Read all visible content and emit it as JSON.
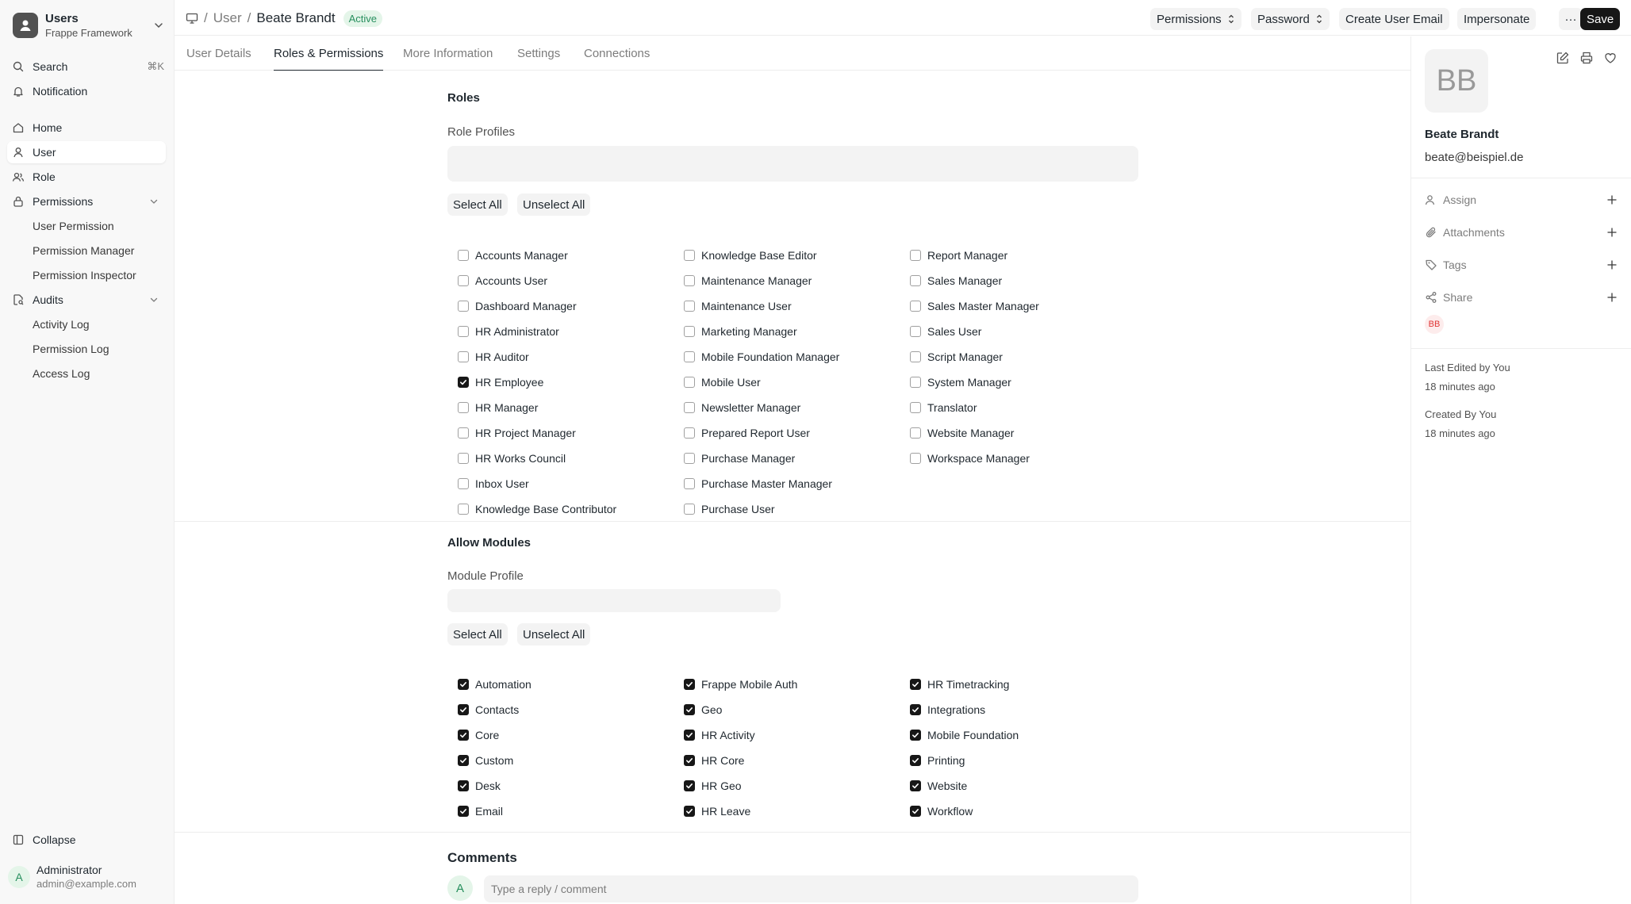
{
  "sidebar": {
    "app_title": "Users",
    "app_subtitle": "Frappe Framework",
    "search": "Search",
    "search_kbd": "⌘K",
    "notification": "Notification",
    "home": "Home",
    "user": "User",
    "role": "Role",
    "permissions": "Permissions",
    "permissions_items": [
      "User Permission",
      "Permission Manager",
      "Permission Inspector"
    ],
    "audits": "Audits",
    "audits_items": [
      "Activity Log",
      "Permission Log",
      "Access Log"
    ],
    "collapse": "Collapse",
    "footer_avatar": "A",
    "footer_name": "Administrator",
    "footer_email": "admin@example.com"
  },
  "header": {
    "crumb_user": "User",
    "crumb_name": "Beate Brandt",
    "status": "Active",
    "permissions_btn": "Permissions",
    "password_btn": "Password",
    "create_email_btn": "Create User Email",
    "impersonate_btn": "Impersonate",
    "more_btn": "···",
    "save_btn": "Save"
  },
  "tabs": [
    "User Details",
    "Roles & Permissions",
    "More Information",
    "Settings",
    "Connections"
  ],
  "roles": {
    "title": "Roles",
    "profile_label": "Role Profiles",
    "select_all": "Select All",
    "unselect_all": "Unselect All",
    "columns": [
      [
        {
          "label": "Accounts Manager",
          "checked": false
        },
        {
          "label": "Accounts User",
          "checked": false
        },
        {
          "label": "Dashboard Manager",
          "checked": false
        },
        {
          "label": "HR Administrator",
          "checked": false
        },
        {
          "label": "HR Auditor",
          "checked": false
        },
        {
          "label": "HR Employee",
          "checked": true
        },
        {
          "label": "HR Manager",
          "checked": false
        },
        {
          "label": "HR Project Manager",
          "checked": false
        },
        {
          "label": "HR Works Council",
          "checked": false
        },
        {
          "label": "Inbox User",
          "checked": false
        },
        {
          "label": "Knowledge Base Contributor",
          "checked": false
        }
      ],
      [
        {
          "label": "Knowledge Base Editor",
          "checked": false
        },
        {
          "label": "Maintenance Manager",
          "checked": false
        },
        {
          "label": "Maintenance User",
          "checked": false
        },
        {
          "label": "Marketing Manager",
          "checked": false
        },
        {
          "label": "Mobile Foundation Manager",
          "checked": false
        },
        {
          "label": "Mobile User",
          "checked": false
        },
        {
          "label": "Newsletter Manager",
          "checked": false
        },
        {
          "label": "Prepared Report User",
          "checked": false
        },
        {
          "label": "Purchase Manager",
          "checked": false
        },
        {
          "label": "Purchase Master Manager",
          "checked": false
        },
        {
          "label": "Purchase User",
          "checked": false
        }
      ],
      [
        {
          "label": "Report Manager",
          "checked": false
        },
        {
          "label": "Sales Manager",
          "checked": false
        },
        {
          "label": "Sales Master Manager",
          "checked": false
        },
        {
          "label": "Sales User",
          "checked": false
        },
        {
          "label": "Script Manager",
          "checked": false
        },
        {
          "label": "System Manager",
          "checked": false
        },
        {
          "label": "Translator",
          "checked": false
        },
        {
          "label": "Website Manager",
          "checked": false
        },
        {
          "label": "Workspace Manager",
          "checked": false
        }
      ]
    ]
  },
  "modules": {
    "title": "Allow Modules",
    "profile_label": "Module Profile",
    "select_all": "Select All",
    "unselect_all": "Unselect All",
    "columns": [
      [
        {
          "label": "Automation",
          "checked": true
        },
        {
          "label": "Contacts",
          "checked": true
        },
        {
          "label": "Core",
          "checked": true
        },
        {
          "label": "Custom",
          "checked": true
        },
        {
          "label": "Desk",
          "checked": true
        },
        {
          "label": "Email",
          "checked": true
        }
      ],
      [
        {
          "label": "Frappe Mobile Auth",
          "checked": true
        },
        {
          "label": "Geo",
          "checked": true
        },
        {
          "label": "HR Activity",
          "checked": true
        },
        {
          "label": "HR Core",
          "checked": true
        },
        {
          "label": "HR Geo",
          "checked": true
        },
        {
          "label": "HR Leave",
          "checked": true
        }
      ],
      [
        {
          "label": "HR Timetracking",
          "checked": true
        },
        {
          "label": "Integrations",
          "checked": true
        },
        {
          "label": "Mobile Foundation",
          "checked": true
        },
        {
          "label": "Printing",
          "checked": true
        },
        {
          "label": "Website",
          "checked": true
        },
        {
          "label": "Workflow",
          "checked": true
        }
      ]
    ]
  },
  "comments": {
    "title": "Comments",
    "avatar": "A",
    "placeholder": "Type a reply / comment"
  },
  "right_panel": {
    "avatar_initials": "BB",
    "name": "Beate Brandt",
    "email": "beate@beispiel.de",
    "assign": "Assign",
    "attachments": "Attachments",
    "tags": "Tags",
    "share": "Share",
    "shared_avatar": "BB",
    "last_edited": "Last Edited by You",
    "last_edited_time": "18 minutes ago",
    "created": "Created By You",
    "created_time": "18 minutes ago"
  }
}
